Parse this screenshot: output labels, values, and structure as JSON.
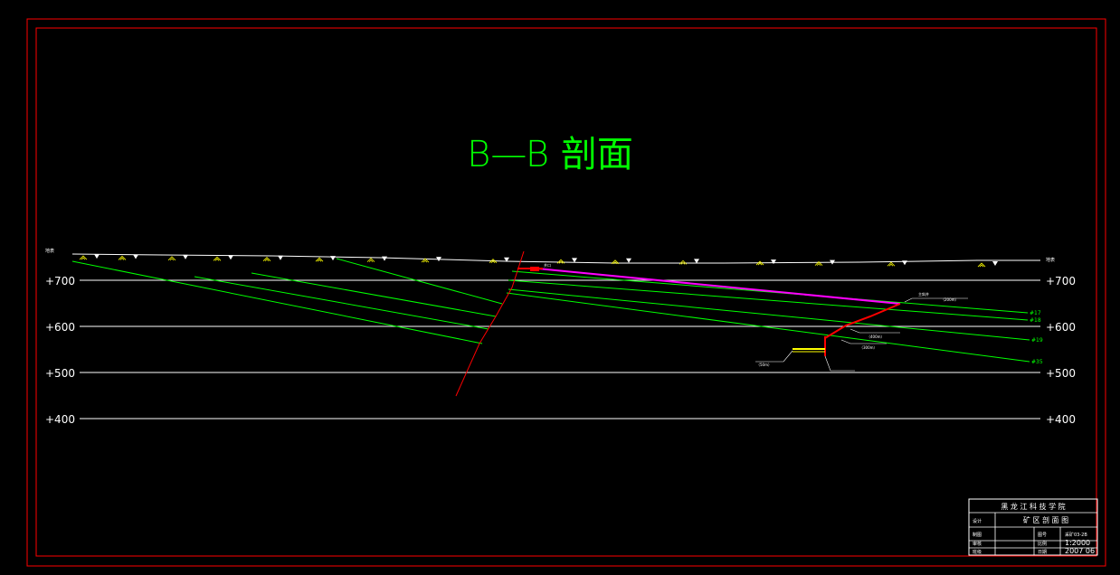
{
  "title": "B—B 剖面",
  "surface_label": "地表",
  "elevations": [
    "+700",
    "+600",
    "+500",
    "+400"
  ],
  "seams": [
    "#17",
    "#18",
    "#19",
    "#35"
  ],
  "mine_labels": [
    "主斜井",
    "（200m）",
    "井口",
    "（400m）",
    "（300m）",
    "（50m）"
  ],
  "title_block": {
    "school": "黑 龙 江 科 技 学 院",
    "drawing_name": "矿 区 剖 面 图",
    "number_label": "图号",
    "number_value": "采矿03-2B",
    "scale_label": "比例",
    "scale_value": "1:2000",
    "date_label": "日期",
    "date_value": "2007 06",
    "row_labels": [
      "设计",
      "制图",
      "审核",
      "班级"
    ]
  },
  "colors": {
    "frame": "#ff0000",
    "coal_seam": "#00ff00",
    "fault": "#ff0000",
    "main_shaft": "#ff00ff",
    "grid": "#ffffff",
    "title": "#00ff00",
    "surface_symbol": "#ffff00"
  }
}
